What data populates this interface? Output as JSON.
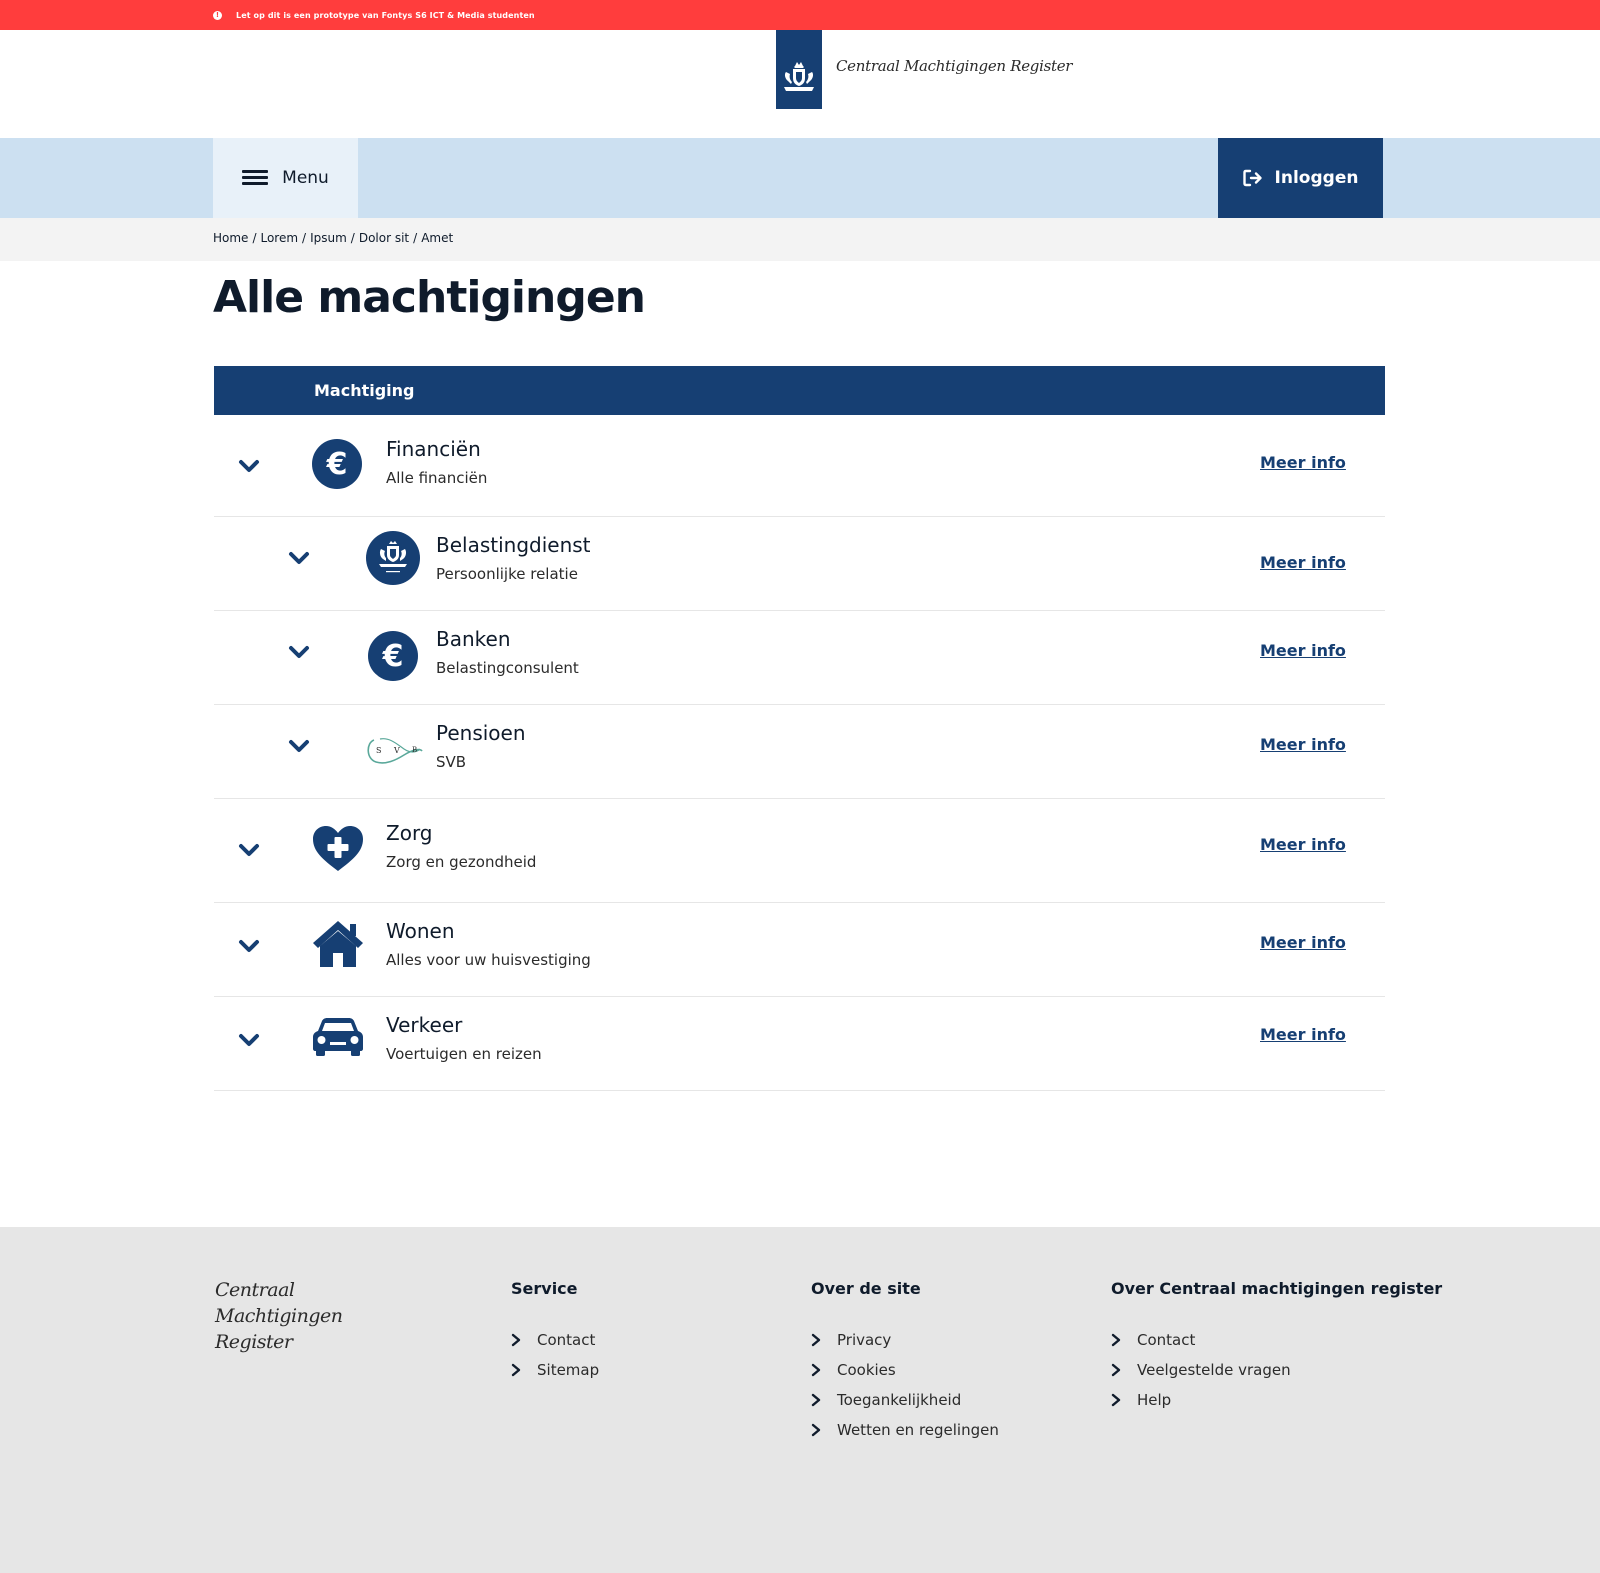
{
  "warning": {
    "text": "Let op dit is een prototype van Fontys S6 ICT & Media studenten"
  },
  "header": {
    "logo_text": "Centraal Machtigingen Register"
  },
  "nav": {
    "menu_label": "Menu",
    "login_label": "Inloggen"
  },
  "breadcrumb": {
    "items": [
      "Home",
      "Lorem",
      "Ipsum",
      "Dolor sit",
      "Amet"
    ]
  },
  "page": {
    "title": "Alle machtigingen"
  },
  "table": {
    "header": "Machtiging",
    "rows": [
      {
        "title": "Financiën",
        "subtitle": "Alle financiën",
        "icon": "euro-icon",
        "link": "Meer info"
      },
      {
        "title": "Belastingdienst",
        "subtitle": "Persoonlijke relatie",
        "icon": "rijksoverheid-crest-icon",
        "link": "Meer info"
      },
      {
        "title": "Banken",
        "subtitle": "Belastingconsulent",
        "icon": "euro-icon",
        "link": "Meer info"
      },
      {
        "title": "Pensioen",
        "subtitle": "SVB",
        "icon": "svb-logo-icon",
        "link": "Meer info"
      },
      {
        "title": "Zorg",
        "subtitle": "Zorg en gezondheid",
        "icon": "heart-plus-icon",
        "link": "Meer info"
      },
      {
        "title": "Wonen",
        "subtitle": "Alles voor uw huisvestiging",
        "icon": "house-icon",
        "link": "Meer info"
      },
      {
        "title": "Verkeer",
        "subtitle": "Voertuigen en reizen",
        "icon": "car-icon",
        "link": "Meer info"
      }
    ]
  },
  "footer": {
    "logo_lines": [
      "Centraal",
      "Machtigingen",
      "Register"
    ],
    "columns": [
      {
        "heading": "Service",
        "links": [
          "Contact",
          "Sitemap"
        ]
      },
      {
        "heading": "Over de site",
        "links": [
          "Privacy",
          "Cookies",
          "Toegankelijkheid",
          "Wetten en regelingen"
        ]
      },
      {
        "heading": "Over Centraal machtigingen register",
        "links": [
          "Contact",
          "Veelgestelde vragen",
          "Help"
        ]
      }
    ]
  },
  "colors": {
    "warning": "#ff3d3d",
    "brand": "#163f73",
    "nav": "#cce0f1",
    "footer": "#e6e6e6"
  }
}
